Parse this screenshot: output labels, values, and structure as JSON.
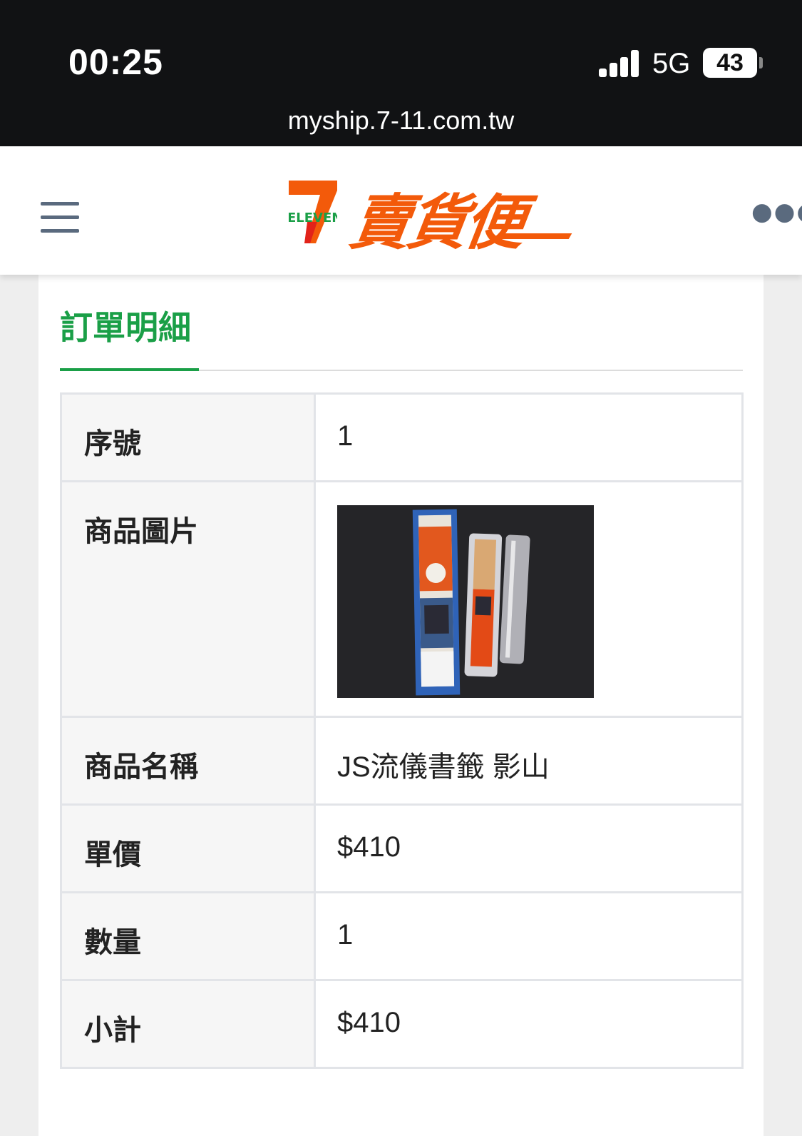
{
  "status_bar": {
    "time": "00:25",
    "network": "5G",
    "battery": "43"
  },
  "browser": {
    "url": "myship.7-11.com.tw"
  },
  "header": {
    "logo_brand": "ELEVEN",
    "logo_title": "賣貨便",
    "menu_icon": "hamburger-icon",
    "more_icon": "ellipsis-icon"
  },
  "section": {
    "title": "訂單明細"
  },
  "order": {
    "rows": [
      {
        "label": "序號",
        "value": "1"
      },
      {
        "label": "商品圖片",
        "value": ""
      },
      {
        "label": "商品名稱",
        "value": "JS流儀書籤 影山"
      },
      {
        "label": "單價",
        "value": "$410"
      },
      {
        "label": "數量",
        "value": "1"
      },
      {
        "label": "小計",
        "value": "$410"
      }
    ]
  },
  "colors": {
    "accent_green": "#1a9f47",
    "brand_orange": "#f35a0a",
    "brand_red": "#e2231a"
  }
}
